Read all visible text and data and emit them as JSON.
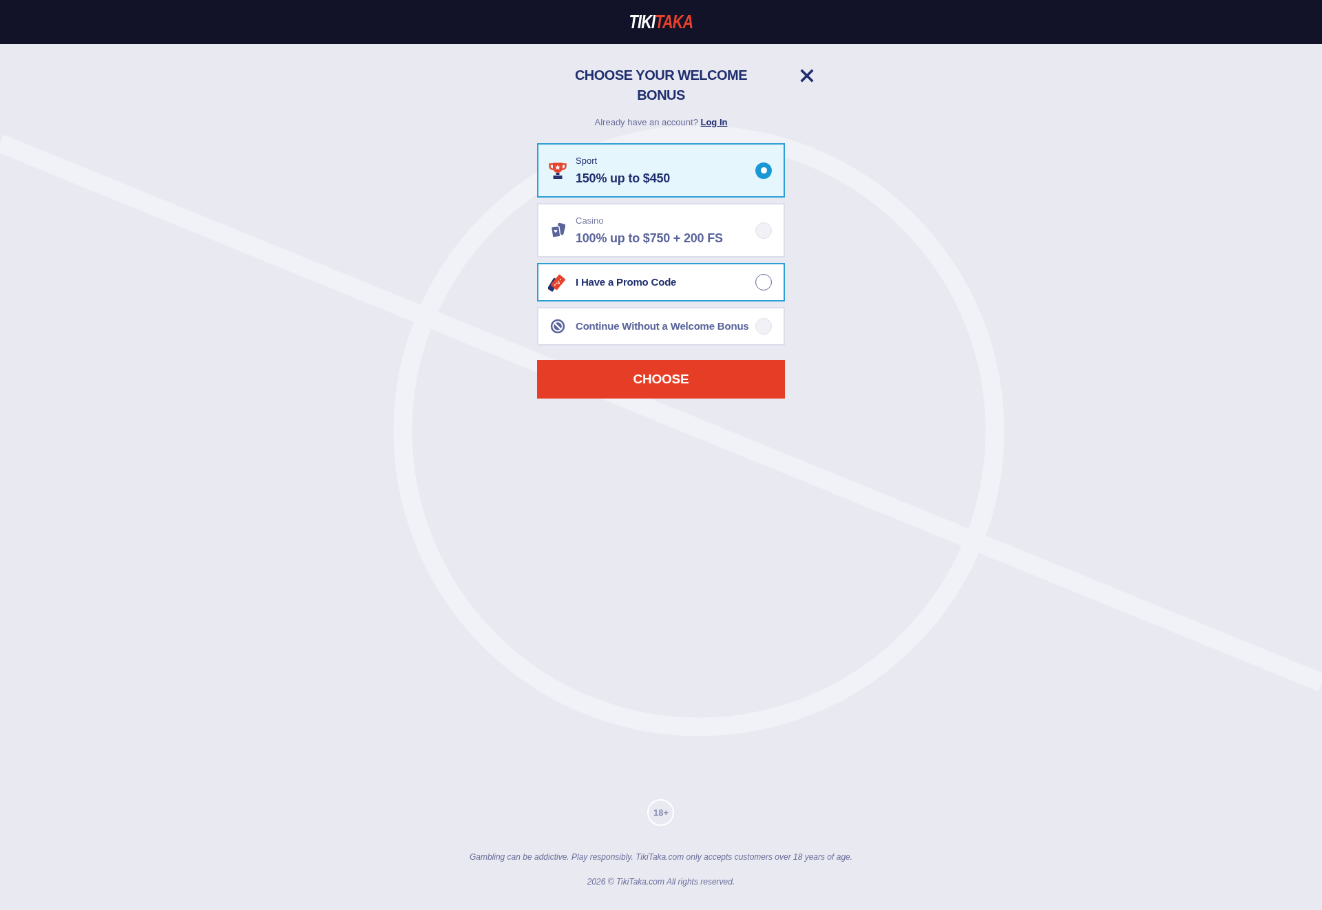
{
  "header": {
    "logo": {
      "main": "TIKI",
      "accent": "TAKA"
    }
  },
  "dialog": {
    "title": "CHOOSE YOUR WELCOME BONUS",
    "login_prompt": {
      "text": "Already have an account?",
      "link": "Log In"
    },
    "options": [
      {
        "kind": "bonus",
        "category": "Sport",
        "offer": "150% up to $450",
        "selected": true,
        "focused": false
      },
      {
        "kind": "bonus",
        "category": "Casino",
        "offer": "100% up to $750 + 200 FS",
        "selected": false,
        "focused": false
      },
      {
        "kind": "choice",
        "label": "I Have a Promo Code",
        "selected": false,
        "focused": true
      },
      {
        "kind": "choice",
        "label": "Continue Without a Welcome Bonus",
        "selected": false,
        "focused": false
      }
    ],
    "submit_button": "CHOOSE"
  },
  "footer": {
    "age_badge": "18+",
    "disclaimer": "Gambling can be addictive. Play responsibly. TikiTaka.com only accepts customers over 18 years of age.",
    "copyright": "2026 © TikiTaka.com All rights reserved."
  }
}
